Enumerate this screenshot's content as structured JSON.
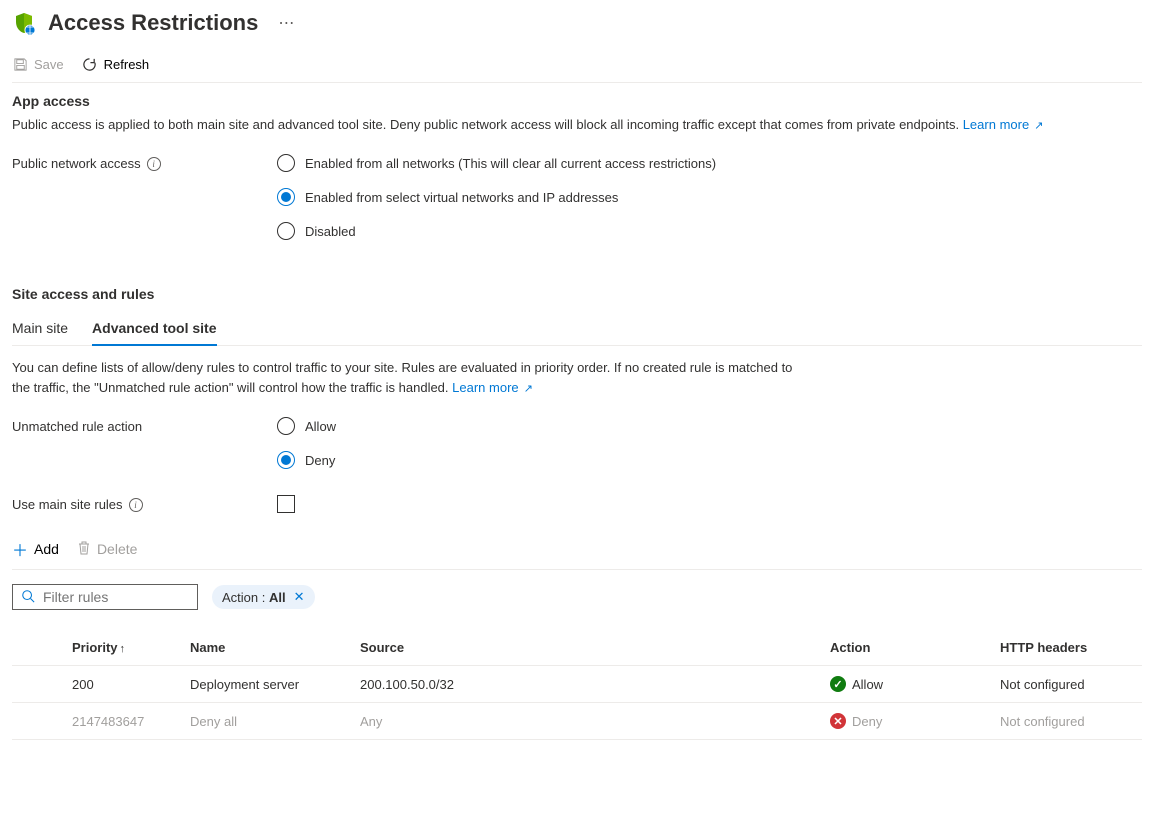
{
  "header": {
    "title": "Access Restrictions"
  },
  "toolbar": {
    "save_label": "Save",
    "refresh_label": "Refresh"
  },
  "app_access": {
    "section_title": "App access",
    "description": "Public access is applied to both main site and advanced tool site. Deny public network access will block all incoming traffic except that comes from private endpoints.",
    "learn_more": "Learn more",
    "public_network_label": "Public network access",
    "options": [
      {
        "label": "Enabled from all networks (This will clear all current access restrictions)",
        "selected": false
      },
      {
        "label": "Enabled from select virtual networks and IP addresses",
        "selected": true
      },
      {
        "label": "Disabled",
        "selected": false
      }
    ]
  },
  "site_access": {
    "section_title": "Site access and rules",
    "tabs": [
      {
        "label": "Main site",
        "active": false
      },
      {
        "label": "Advanced tool site",
        "active": true
      }
    ],
    "description": "You can define lists of allow/deny rules to control traffic to your site. Rules are evaluated in priority order. If no created rule is matched to the traffic, the \"Unmatched rule action\" will control how the traffic is handled.",
    "learn_more": "Learn more",
    "unmatched_label": "Unmatched rule action",
    "unmatched_options": [
      {
        "label": "Allow",
        "selected": false
      },
      {
        "label": "Deny",
        "selected": true
      }
    ],
    "use_main_site_label": "Use main site rules",
    "use_main_site_checked": false
  },
  "commands": {
    "add_label": "Add",
    "delete_label": "Delete"
  },
  "filter": {
    "placeholder": "Filter rules",
    "pill_prefix": "Action : ",
    "pill_value": "All"
  },
  "table": {
    "columns": {
      "priority": "Priority",
      "name": "Name",
      "source": "Source",
      "action": "Action",
      "http": "HTTP headers"
    },
    "rows": [
      {
        "priority": "200",
        "name": "Deployment server",
        "source": "200.100.50.0/32",
        "action": "Allow",
        "action_kind": "allow",
        "http": "Not configured",
        "muted": false
      },
      {
        "priority": "2147483647",
        "name": "Deny all",
        "source": "Any",
        "action": "Deny",
        "action_kind": "deny",
        "http": "Not configured",
        "muted": true
      }
    ]
  }
}
